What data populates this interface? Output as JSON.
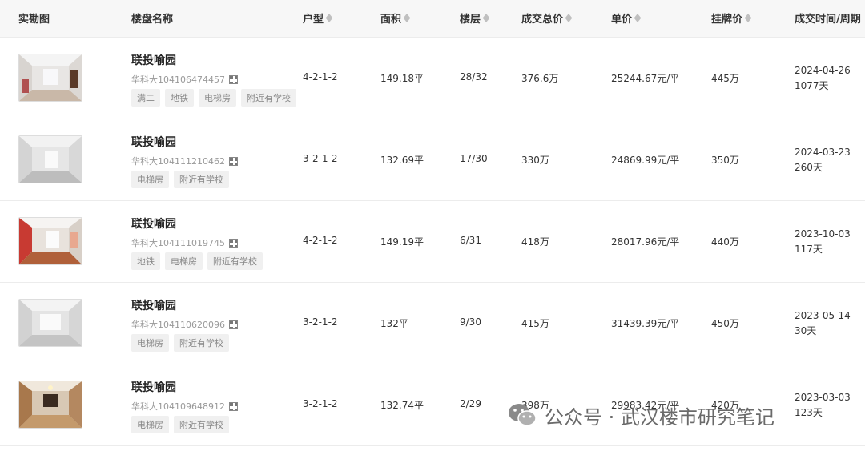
{
  "columns": {
    "photo": "实勘图",
    "name": "楼盘名称",
    "layout": "户型",
    "area": "面积",
    "floor": "楼层",
    "total": "成交总价",
    "unit_price": "单价",
    "list_price": "挂牌价",
    "date_period": "成交时间/周期"
  },
  "rows": [
    {
      "name": "联投喻园",
      "code": "华科大104106474457",
      "tags": [
        "满二",
        "地铁",
        "电梯房",
        "附近有学校"
      ],
      "layout": "4-2-1-2",
      "area": "149.18平",
      "floor": "28/32",
      "total": "376.6万",
      "unit_price": "25244.67元/平",
      "list_price": "445万",
      "date": "2024-04-26",
      "period": "1077天"
    },
    {
      "name": "联投喻园",
      "code": "华科大104111210462",
      "tags": [
        "电梯房",
        "附近有学校"
      ],
      "layout": "3-2-1-2",
      "area": "132.69平",
      "floor": "17/30",
      "total": "330万",
      "unit_price": "24869.99元/平",
      "list_price": "350万",
      "date": "2024-03-23",
      "period": "260天"
    },
    {
      "name": "联投喻园",
      "code": "华科大104111019745",
      "tags": [
        "地铁",
        "电梯房",
        "附近有学校"
      ],
      "layout": "4-2-1-2",
      "area": "149.19平",
      "floor": "6/31",
      "total": "418万",
      "unit_price": "28017.96元/平",
      "list_price": "440万",
      "date": "2023-10-03",
      "period": "117天"
    },
    {
      "name": "联投喻园",
      "code": "华科大104110620096",
      "tags": [
        "电梯房",
        "附近有学校"
      ],
      "layout": "3-2-1-2",
      "area": "132平",
      "floor": "9/30",
      "total": "415万",
      "unit_price": "31439.39元/平",
      "list_price": "450万",
      "date": "2023-05-14",
      "period": "30天"
    },
    {
      "name": "联投喻园",
      "code": "华科大104109648912",
      "tags": [
        "电梯房",
        "附近有学校"
      ],
      "layout": "3-2-1-2",
      "area": "132.74平",
      "floor": "2/29",
      "total": "398万",
      "unit_price": "29983.42元/平",
      "list_price": "420万",
      "date": "2023-03-03",
      "period": "123天"
    }
  ],
  "watermark": {
    "text": "公众号 · 武汉楼市研究笔记",
    "icon": "wechat-icon"
  },
  "colors": {
    "header_bg": "#f7f7f7",
    "tag_bg": "#f0f0f0",
    "text": "#333333",
    "muted": "#999999"
  }
}
